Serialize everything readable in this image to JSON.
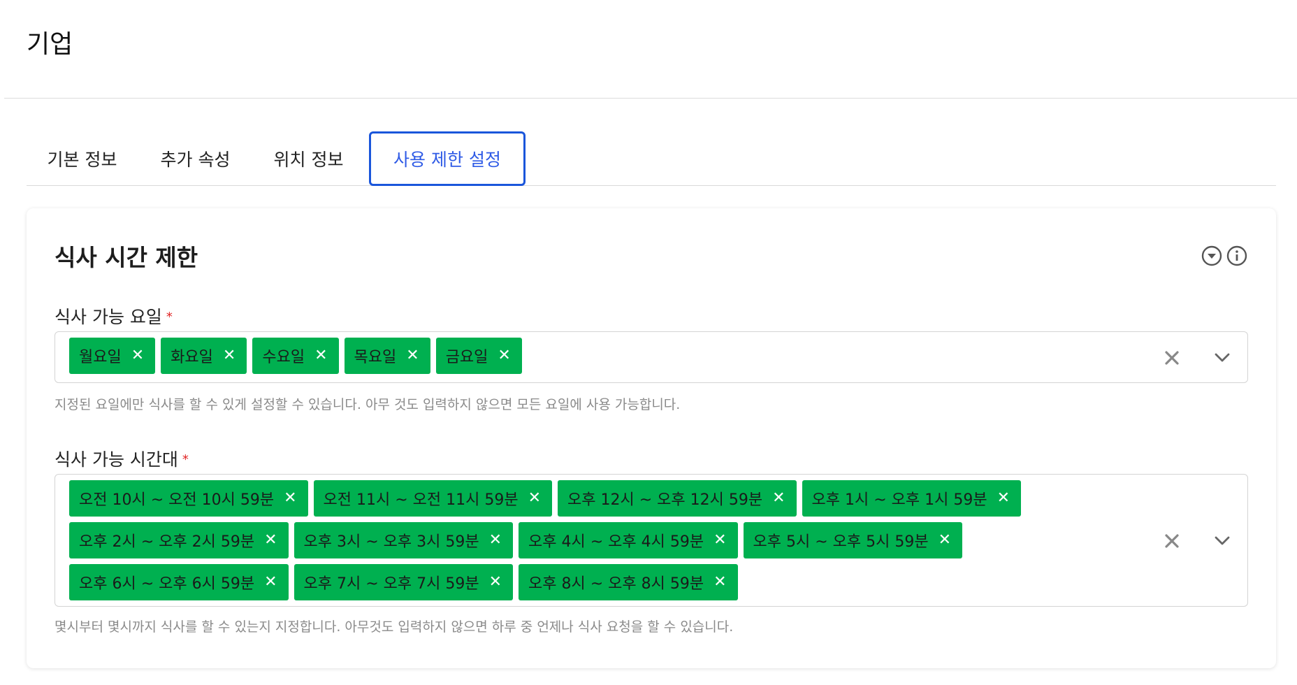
{
  "page": {
    "title": "기업"
  },
  "tabs": [
    {
      "label": "기본 정보"
    },
    {
      "label": "추가 속성"
    },
    {
      "label": "위치 정보"
    },
    {
      "label": "사용 제한 설정",
      "active": true
    }
  ],
  "card": {
    "title": "식사 시간 제한",
    "icons": [
      "collapse-circle-icon",
      "info-circle-icon"
    ]
  },
  "days_field": {
    "label": "식사 가능 요일",
    "required_mark": "*",
    "tags": [
      "월요일",
      "화요일",
      "수요일",
      "목요일",
      "금요일"
    ],
    "help": "지정된 요일에만 식사를 할 수 있게 설정할 수 있습니다. 아무 것도 입력하지 않으면 모든 요일에 사용 가능합니다."
  },
  "times_field": {
    "label": "식사 가능 시간대",
    "required_mark": "*",
    "tags": [
      "오전 10시 ~ 오전 10시 59분",
      "오전 11시 ~ 오전 11시 59분",
      "오후 12시 ~ 오후 12시 59분",
      "오후 1시 ~ 오후 1시 59분",
      "오후 2시 ~ 오후 2시 59분",
      "오후 3시 ~ 오후 3시 59분",
      "오후 4시 ~ 오후 4시 59분",
      "오후 5시 ~ 오후 5시 59분",
      "오후 6시 ~ 오후 6시 59분",
      "오후 7시 ~ 오후 7시 59분",
      "오후 8시 ~ 오후 8시 59분"
    ],
    "help": "몇시부터 몇시까지 식사를 할 수 있는지 지정합니다. 아무것도 입력하지 않으면 하루 중 언제나 식사 요청을 할 수 있습니다."
  },
  "colors": {
    "tag_bg": "#00b050",
    "active_tab": "#1a56db",
    "required": "#e02424"
  }
}
